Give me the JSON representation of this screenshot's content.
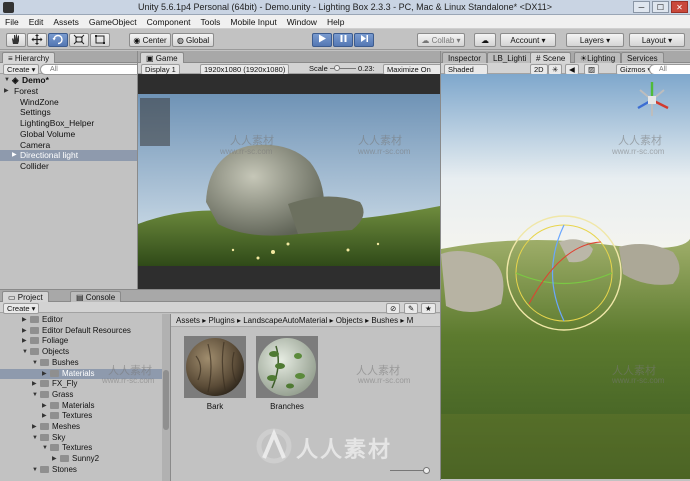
{
  "window": {
    "title": "Unity 5.6.1p4 Personal (64bit) - Demo.unity - Lighting Box 2.3.3 - PC, Mac & Linux Standalone* <DX11>",
    "min_glyph": "─",
    "max_glyph": "☐",
    "close_glyph": "✕"
  },
  "menu": [
    "File",
    "Edit",
    "Assets",
    "GameObject",
    "Component",
    "Tools",
    "Mobile Input",
    "Window",
    "Help"
  ],
  "toolbar": {
    "pivot": "Center",
    "space": "Global",
    "collab": "Collab ▾",
    "account": "Account ▾",
    "layers": "Layers ▾",
    "layout": "Layout ▾"
  },
  "hierarchy": {
    "tab": "Hierarchy",
    "create": "Create ▾",
    "search": "All",
    "scene": "Demo*",
    "items": [
      "Forest",
      "WindZone",
      "Settings",
      "LightingBox_Helper",
      "Global Volume",
      "Camera",
      "Directional light",
      "Collider"
    ]
  },
  "game": {
    "tab": "Game",
    "display": "Display 1",
    "resolution": "1920x1080 (1920x1080)",
    "scale_label": "Scale",
    "scale_value": "0.23:",
    "maximize": "Maximize On Pla"
  },
  "scene_tabs": [
    "Inspector",
    "LB_Lighti",
    "Scene",
    "Lighting",
    "Services"
  ],
  "scene": {
    "shading": "Shaded",
    "mode2d": "2D",
    "gizmos": "Gizmos ▾",
    "search": "All"
  },
  "project": {
    "tab": "Project",
    "console_tab": "Console",
    "create": "Create ▾",
    "tree": [
      {
        "label": "Editor",
        "depth": 0,
        "open": false
      },
      {
        "label": "Editor Default Resources",
        "depth": 0,
        "open": false
      },
      {
        "label": "Foliage",
        "depth": 0,
        "open": false
      },
      {
        "label": "Objects",
        "depth": 0,
        "open": true
      },
      {
        "label": "Bushes",
        "depth": 1,
        "open": true
      },
      {
        "label": "Materials",
        "depth": 2,
        "open": false,
        "selected": true
      },
      {
        "label": "FX_Fly",
        "depth": 1,
        "open": false
      },
      {
        "label": "Grass",
        "depth": 1,
        "open": true
      },
      {
        "label": "Materials",
        "depth": 2,
        "open": false
      },
      {
        "label": "Textures",
        "depth": 2,
        "open": false
      },
      {
        "label": "Meshes",
        "depth": 1,
        "open": false
      },
      {
        "label": "Sky",
        "depth": 1,
        "open": true
      },
      {
        "label": "Textures",
        "depth": 2,
        "open": true
      },
      {
        "label": "Sunny2",
        "depth": 3,
        "open": false
      },
      {
        "label": "Stones",
        "depth": 1,
        "open": true
      }
    ],
    "breadcrumb": [
      "Assets",
      "Plugins",
      "LandscapeAutoMaterial",
      "Objects",
      "Bushes",
      "M"
    ],
    "assets": [
      {
        "name": "Bark"
      },
      {
        "name": "Branches"
      }
    ]
  },
  "watermarks": {
    "text": "人人素材",
    "url": "www.rr-sc.com"
  }
}
